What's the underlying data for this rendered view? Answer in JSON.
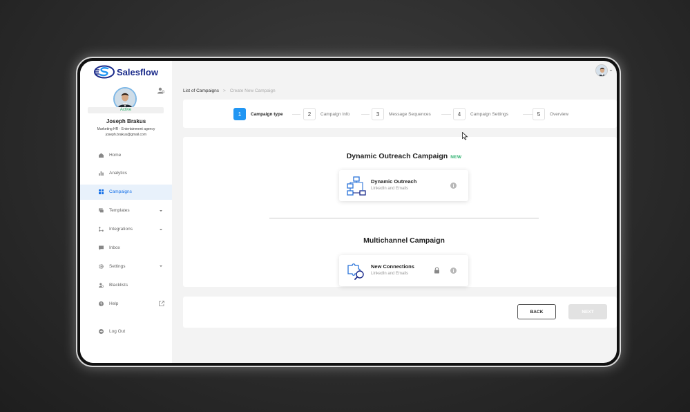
{
  "app": {
    "name": "Salesflow",
    "accent_color": "#2196f3",
    "brand_color": "#1a2a8a",
    "success_color": "#2cb06e"
  },
  "user": {
    "name": "Joseph Brakus",
    "role": "Marketing HR - Entertainment agency",
    "email": "joseph.brakus@gmail.com",
    "status": "Active"
  },
  "sidebar": {
    "items": [
      {
        "label": "Home",
        "icon": "home-icon"
      },
      {
        "label": "Analytics",
        "icon": "analytics-icon"
      },
      {
        "label": "Campaigns",
        "icon": "campaigns-icon",
        "active": true
      },
      {
        "label": "Templates",
        "icon": "templates-icon",
        "has_dropdown": true
      },
      {
        "label": "Integrations",
        "icon": "integrations-icon",
        "has_dropdown": true
      },
      {
        "label": "Inbox",
        "icon": "inbox-icon"
      },
      {
        "label": "Settings",
        "icon": "settings-icon",
        "has_dropdown": true
      },
      {
        "label": "Blacklists",
        "icon": "blacklists-icon"
      },
      {
        "label": "Help",
        "icon": "help-icon",
        "external": true
      }
    ],
    "logout_label": "Log Out"
  },
  "breadcrumb": {
    "parent": "List of Campaigns",
    "separator": ">",
    "current": "Create New Campaign"
  },
  "steps": [
    {
      "number": "1",
      "label": "Campaign type",
      "active": true
    },
    {
      "number": "2",
      "label": "Campaign Info"
    },
    {
      "number": "3",
      "label": "Message Sequences"
    },
    {
      "number": "4",
      "label": "Campaign Settings"
    },
    {
      "number": "5",
      "label": "Overview"
    }
  ],
  "sections": {
    "dynamic": {
      "title": "Dynamic Outreach Campaign",
      "badge": "NEW",
      "option": {
        "title": "Dynamic Outreach",
        "subtitle": "LinkedIn and Emails",
        "icon": "flowchart-icon"
      }
    },
    "multichannel": {
      "title": "Multichannel Campaign",
      "option": {
        "title": "New Connections",
        "subtitle": "LinkedIn and Emails",
        "icon": "puzzle-search-icon",
        "locked": true
      }
    }
  },
  "footer": {
    "back_label": "BACK",
    "next_label": "NEXT",
    "next_disabled": true
  }
}
